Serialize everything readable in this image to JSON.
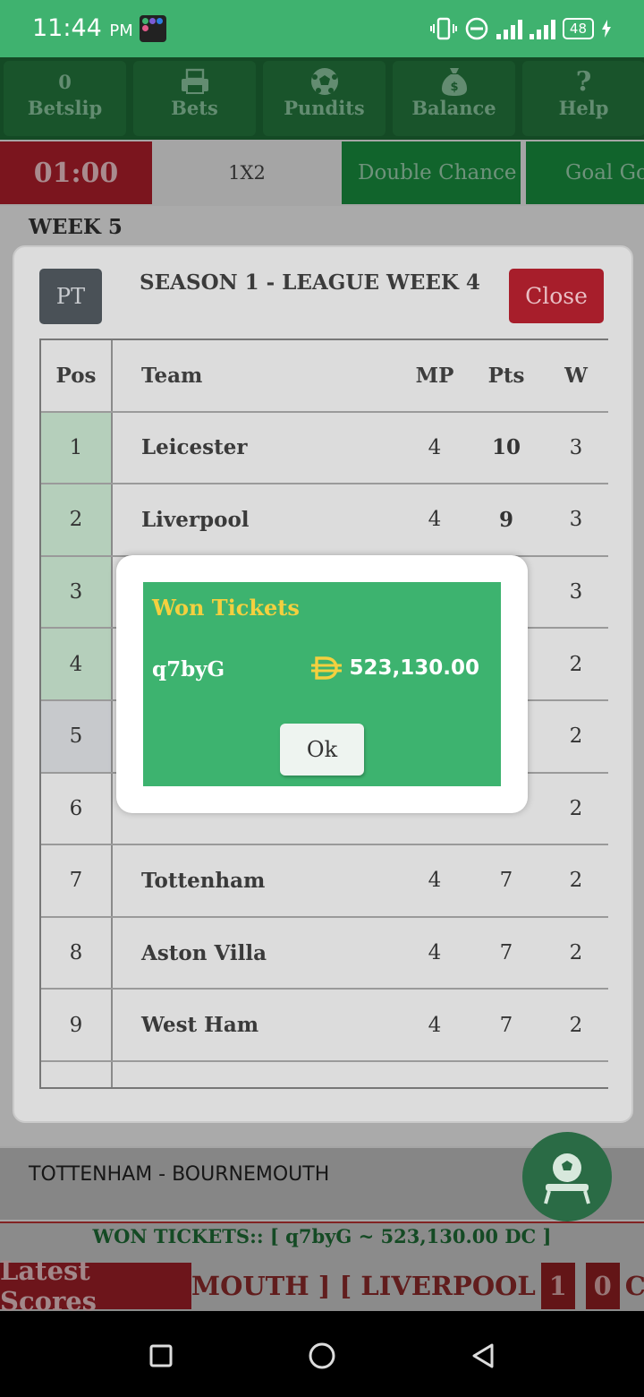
{
  "status_bar": {
    "time": "11:44",
    "ampm": "PM",
    "battery": "48"
  },
  "nav": [
    {
      "top": "0",
      "label": "Betslip",
      "icon": "betslip-count"
    },
    {
      "top": "",
      "label": "Bets",
      "icon": "printer-icon"
    },
    {
      "top": "",
      "label": "Pundits",
      "icon": "soccer-ball-icon"
    },
    {
      "top": "",
      "label": "Balance",
      "icon": "money-bag-icon"
    },
    {
      "top": "?",
      "label": "Help",
      "icon": "question-icon"
    }
  ],
  "markets": {
    "timer": "01:00",
    "tab_1x2": "1X2",
    "tab_double": "Double Chance",
    "tab_goal": "Goal Go"
  },
  "week_label": "WEEK 5",
  "modal": {
    "pt_label": "PT",
    "title": "SEASON 1 - LEAGUE WEEK 4",
    "close_label": "Close",
    "headers": {
      "pos": "Pos",
      "team": "Team",
      "mp": "MP",
      "pts": "Pts",
      "w": "W"
    },
    "rows": [
      {
        "pos": "1",
        "team": "Leicester",
        "mp": "4",
        "pts": "10",
        "w": "3"
      },
      {
        "pos": "2",
        "team": "Liverpool",
        "mp": "4",
        "pts": "9",
        "w": "3"
      },
      {
        "pos": "3",
        "team": "",
        "mp": "",
        "pts": "",
        "w": "3"
      },
      {
        "pos": "4",
        "team": "",
        "mp": "",
        "pts": "",
        "w": "2"
      },
      {
        "pos": "5",
        "team": "",
        "mp": "",
        "pts": "",
        "w": "2"
      },
      {
        "pos": "6",
        "team": "",
        "mp": "",
        "pts": "",
        "w": "2"
      },
      {
        "pos": "7",
        "team": "Tottenham",
        "mp": "4",
        "pts": "7",
        "w": "2"
      },
      {
        "pos": "8",
        "team": "Aston Villa",
        "mp": "4",
        "pts": "7",
        "w": "2"
      },
      {
        "pos": "9",
        "team": "West Ham",
        "mp": "4",
        "pts": "7",
        "w": "2"
      }
    ]
  },
  "won_dialog": {
    "title": "Won Tickets",
    "ticket_id": "q7byG",
    "currency_symbol": "Đ",
    "amount": "523,130.00",
    "ok_label": "Ok"
  },
  "match": "TOTTENHAM - BOURNEMOUTH",
  "won_strip": "WON TICKETS:: [ q7byG ~ 523,130.00 DC ]",
  "ticker": {
    "label": "Latest Scores",
    "segment_1": "MOUTH ] [ LIVERPOOL",
    "score_home": "1",
    "score_away": "0",
    "segment_2": "CRYS"
  },
  "colors": {
    "status": "#3fb26f",
    "nav": "#1d6b35",
    "accent_red": "#b11f2b",
    "won_green": "#3db36f",
    "won_gold": "#f4d03f"
  }
}
